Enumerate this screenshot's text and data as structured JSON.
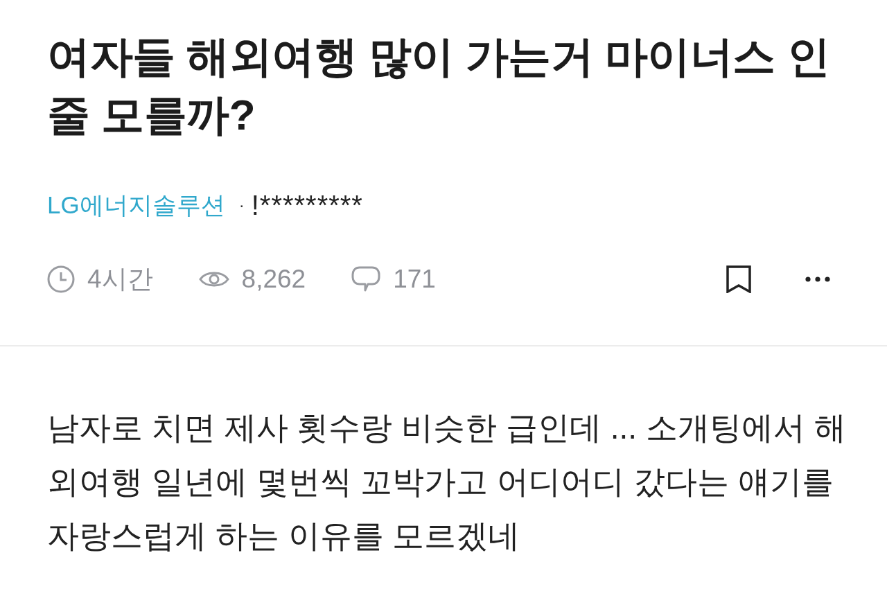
{
  "post": {
    "title": "여자들 해외여행 많이 가는거 마이너스 인줄 모를까?",
    "author": {
      "company": "LG에너지솔루션",
      "separator": "·",
      "nickname": "!*********"
    },
    "stats": [
      {
        "kind": "time",
        "text": "4시간"
      },
      {
        "kind": "views",
        "text": "8,262"
      },
      {
        "kind": "comments",
        "text": "171"
      }
    ],
    "bookmarked": false,
    "body": "남자로 치면 제사 횟수랑 비슷한 급인데 ... 소개팅에서 해외여행 일년에 몇번씩 꼬박가고 어디어디 갔다는 얘기를 자랑스럽게 하는 이유를 모르겠네"
  }
}
